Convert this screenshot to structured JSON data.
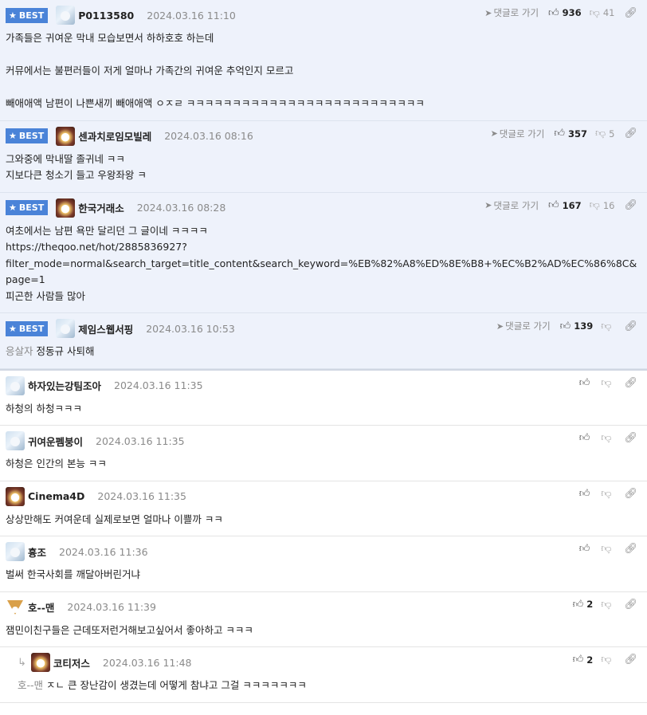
{
  "labels": {
    "best": "BEST",
    "goto": "댓글로 가기"
  },
  "best": [
    {
      "nick": "P0113580",
      "date": "2024.03.16 11:10",
      "likes": "936",
      "dislikes": "41",
      "avatar": "seal",
      "body": "가족들은 귀여운 막내 모습보면서 하하호호 하는데\n\n커뮤에서는 불편러들이 저게 얼마나 가족간의 귀여운 추억인지 모르고\n\n빼애애액 남편이 나쁜새끼 빼애애액 ㅇㅈㄹ ㅋㅋㅋㅋㅋㅋㅋㅋㅋㅋㅋㅋㅋㅋㅋㅋㅋㅋㅋㅋㅋㅋㅋㅋㅋㅋ"
    },
    {
      "nick": "센과치로임모빌레",
      "date": "2024.03.16 08:16",
      "likes": "357",
      "dislikes": "5",
      "avatar": "bear",
      "body": "그와중에 막내딸 졸귀네 ㅋㅋ\n지보다큰 청소기 들고 우왕좌왕 ㅋ"
    },
    {
      "nick": "한국거래소",
      "date": "2024.03.16 08:28",
      "likes": "167",
      "dislikes": "16",
      "avatar": "bear",
      "body": "여초에서는 남편 욕만 달리던 그 글이네 ㅋㅋㅋㅋ\nhttps://theqoo.net/hot/2885836927?\nfilter_mode=normal&search_target=title_content&search_keyword=%EB%82%A8%ED%8E%B8+%EC%B2%AD%EC%86%8C&page=1\n피곤한 사람들 많아"
    },
    {
      "nick": "제임스웹서핑",
      "date": "2024.03.16 10:53",
      "likes": "139",
      "dislikes": "",
      "avatar": "seal",
      "mention": "응살자",
      "body": "정동규 사퇴해"
    }
  ],
  "normal": [
    {
      "nick": "하자있는강팀조아",
      "date": "2024.03.16 11:35",
      "likes": "",
      "avatar": "seal",
      "body": "하청의 하청ㅋㅋㅋ"
    },
    {
      "nick": "귀여운펨붕이",
      "date": "2024.03.16 11:35",
      "likes": "",
      "avatar": "seal",
      "body": "하청은 인간의 본능 ㅋㅋ"
    },
    {
      "nick": "Cinema4D",
      "date": "2024.03.16 11:35",
      "likes": "",
      "avatar": "bear",
      "body": "상상만해도 커여운데 실제로보면 얼마나 이쁠까 ㅋㅋ"
    },
    {
      "nick": "흉조",
      "date": "2024.03.16 11:36",
      "likes": "",
      "avatar": "seal",
      "body": "벌써 한국사회를 깨달아버린거냐"
    },
    {
      "nick": "호--맨",
      "date": "2024.03.16 11:39",
      "likes": "2",
      "avatar": "fox",
      "body": "잼민이친구들은 근데또저런거해보고싶어서 좋아하고 ㅋㅋㅋ"
    },
    {
      "nick": "코티저스",
      "date": "2024.03.16 11:48",
      "likes": "2",
      "avatar": "bear",
      "reply": true,
      "mention": "호--맨",
      "body": "ㅈㄴ 큰 장난감이 생겼는데 어떻게 참냐고 그걸 ㅋㅋㅋㅋㅋㅋㅋ"
    }
  ],
  "colors": {
    "best_bg": "#eef2fb",
    "badge": "#4a83d8"
  },
  "icons": [
    "star-icon",
    "send-arrow-icon",
    "thumb-up-icon",
    "thumb-down-icon",
    "link-icon",
    "reply-arrow-icon"
  ]
}
